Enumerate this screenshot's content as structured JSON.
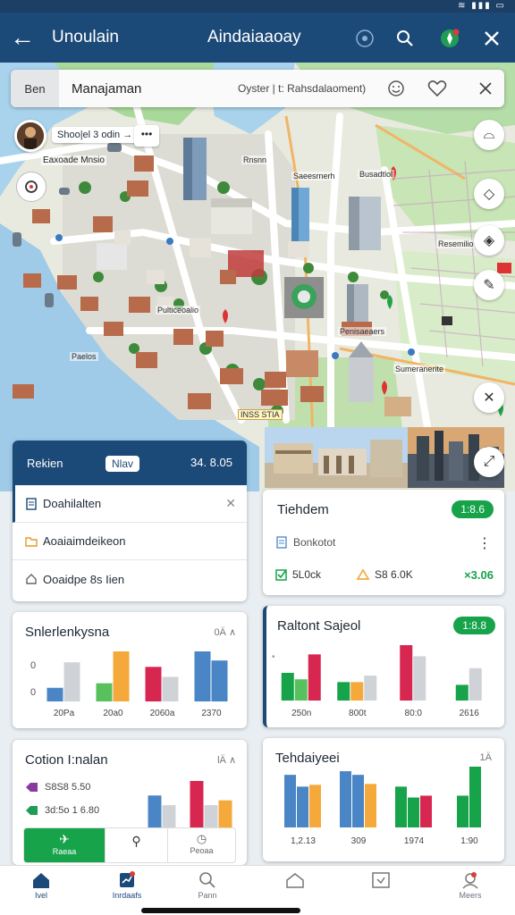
{
  "app_bar": {
    "app_name": "Unoulain",
    "title": "Aindaiaaoay"
  },
  "map_search": {
    "filter_label": "Ben",
    "query": "Manajaman",
    "breadcrumb": "Oyster | t: Rahsdalaoment)"
  },
  "location_chip": {
    "label": "Shoo|el 3 odin →",
    "sub_label": "Eaxoade Mnsio",
    "more_label": "•••"
  },
  "map_labels": {
    "bldg_a": "Pulticeoalio",
    "poi_a": "Rnsnn",
    "poi_b": "Saeesrnerh",
    "poi_c": "Busadtlol",
    "poi_d": "Resemilio",
    "poi_e": "Paelos",
    "poi_f": "Sumeranerite",
    "street": "Penisaeaers",
    "tag": "INSS STIA"
  },
  "tasks_card": {
    "title": "Rekien",
    "badge": "Nlav",
    "count": "34. 8.05",
    "items": [
      {
        "label": "Doahilalten",
        "icon": "document-icon"
      },
      {
        "label": "Aoaiaimdeikeon",
        "icon": "folder-icon"
      },
      {
        "label": "Ooaidpe 8s Iien",
        "icon": "home-icon"
      }
    ]
  },
  "tiehdem_card": {
    "title": "Tiehdem",
    "pill": "1:8.6",
    "row_label": "Bonkotot",
    "stat_1": "5L0ck",
    "stat_2": "S8 6.0K",
    "stat_3": "×3.06"
  },
  "sales_card": {
    "title": "Snlerlenkysna",
    "corner": "0Ä ∧",
    "y_ticks": [
      "0",
      "0"
    ]
  },
  "patient_card": {
    "title": "Raltont Sajeol",
    "pill": "1:8.8",
    "side_tick": "•"
  },
  "cotion_card": {
    "title": "Cotion I:nalan",
    "corner": "lÄ ∧",
    "rows": [
      "S8S8 5.50",
      "3d:5o 1 6.80"
    ],
    "tabs": [
      "Raeaa",
      "",
      "Peoaa"
    ]
  },
  "tehdaiyeei_card": {
    "title": "Tehdaiyeei",
    "corner": "1Ä"
  },
  "nav": {
    "items": [
      "Ivel",
      "Inrdaafs",
      "Pann",
      "",
      "",
      "Meers"
    ]
  },
  "colors": {
    "primary": "#1c4a78",
    "green": "#16a34a",
    "blue": "#4a86c5",
    "orange": "#f5a93b",
    "red": "#d7264f",
    "gray": "#cfd3d7",
    "light_green": "#58c15e"
  },
  "chart_data": [
    {
      "type": "bar",
      "title": "Snlerlenkysna",
      "categories": [
        "20Pa",
        "20a0",
        "2060a",
        "2370"
      ],
      "series": [
        {
          "name": "",
          "values": [
            15,
            0,
            0,
            55
          ]
        },
        {
          "name": "",
          "values": [
            43,
            0,
            0,
            0
          ]
        },
        {
          "name": "",
          "values": [
            0,
            20,
            0,
            0
          ]
        },
        {
          "name": "",
          "values": [
            0,
            55,
            0,
            0
          ]
        },
        {
          "name": "",
          "values": [
            0,
            0,
            38,
            0
          ]
        },
        {
          "name": "",
          "values": [
            0,
            0,
            27,
            0
          ]
        },
        {
          "name": "",
          "values": [
            0,
            0,
            0,
            45
          ]
        }
      ]
    },
    {
      "type": "bar",
      "title": "Raltont Sajeol",
      "categories": [
        "250n",
        "800t",
        "80:0",
        "2616"
      ],
      "series": [
        {
          "name": "",
          "values": [
            30,
            20,
            0,
            17
          ]
        },
        {
          "name": "",
          "values": [
            23,
            0,
            0,
            0
          ]
        },
        {
          "name": "",
          "values": [
            50,
            0,
            60,
            0
          ]
        },
        {
          "name": "",
          "values": [
            0,
            20,
            0,
            0
          ]
        },
        {
          "name": "",
          "values": [
            0,
            27,
            48,
            35
          ]
        }
      ]
    },
    {
      "type": "bar",
      "title": "Cotion I:nalan",
      "categories": [
        "",
        ""
      ],
      "series": [
        {
          "name": "",
          "values": [
            33,
            0
          ]
        },
        {
          "name": "",
          "values": [
            23,
            0
          ]
        },
        {
          "name": "",
          "values": [
            0,
            48
          ]
        },
        {
          "name": "",
          "values": [
            0,
            23
          ]
        },
        {
          "name": "",
          "values": [
            0,
            28
          ]
        }
      ]
    },
    {
      "type": "bar",
      "title": "Tehdaiyeei",
      "categories": [
        "1,2.13",
        "309",
        "1974",
        "1:90"
      ],
      "series": [
        {
          "name": "",
          "values": [
            58,
            62,
            0,
            0
          ]
        },
        {
          "name": "",
          "values": [
            45,
            58,
            0,
            0
          ]
        },
        {
          "name": "",
          "values": [
            47,
            48,
            0,
            0
          ]
        },
        {
          "name": "",
          "values": [
            0,
            0,
            45,
            35
          ]
        },
        {
          "name": "",
          "values": [
            0,
            0,
            33,
            67
          ]
        },
        {
          "name": "",
          "values": [
            0,
            0,
            35,
            0
          ]
        }
      ]
    }
  ]
}
